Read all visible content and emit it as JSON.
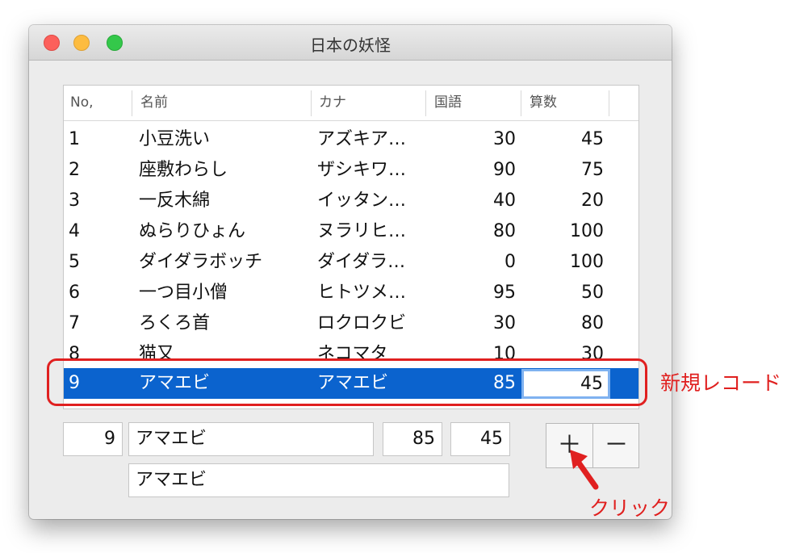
{
  "window": {
    "title": "日本の妖怪"
  },
  "table": {
    "columns": [
      "No,",
      "名前",
      "カナ",
      "国語",
      "算数"
    ],
    "rows": [
      {
        "no": "1",
        "name": "小豆洗い",
        "kana": "アズキア…",
        "kokugo": "30",
        "sansu": "45"
      },
      {
        "no": "2",
        "name": "座敷わらし",
        "kana": "ザシキワ…",
        "kokugo": "90",
        "sansu": "75"
      },
      {
        "no": "3",
        "name": "一反木綿",
        "kana": "イッタン…",
        "kokugo": "40",
        "sansu": "20"
      },
      {
        "no": "4",
        "name": "ぬらりひょん",
        "kana": "ヌラリヒ…",
        "kokugo": "80",
        "sansu": "100"
      },
      {
        "no": "5",
        "name": "ダイダラボッチ",
        "kana": "ダイダラ…",
        "kokugo": "0",
        "sansu": "100"
      },
      {
        "no": "6",
        "name": "一つ目小僧",
        "kana": "ヒトツメ…",
        "kokugo": "95",
        "sansu": "50"
      },
      {
        "no": "7",
        "name": "ろくろ首",
        "kana": "ロクロクビ",
        "kokugo": "30",
        "sansu": "80"
      },
      {
        "no": "8",
        "name": "猫又",
        "kana": "ネコマタ",
        "kokugo": "10",
        "sansu": "30"
      },
      {
        "no": "9",
        "name": "アマエビ",
        "kana": "アマエビ",
        "kokugo": "85",
        "sansu": "45"
      }
    ],
    "selected_row": 9
  },
  "form": {
    "no": "9",
    "name": "アマエビ",
    "kokugo": "85",
    "sansu": "45",
    "kana": "アマエビ"
  },
  "buttons": {
    "add": "＋",
    "remove": "－"
  },
  "annotations": {
    "new_record": "新規レコード",
    "click": "クリック",
    "color": "#e02020"
  },
  "colors": {
    "selection": "#0b63ce"
  }
}
